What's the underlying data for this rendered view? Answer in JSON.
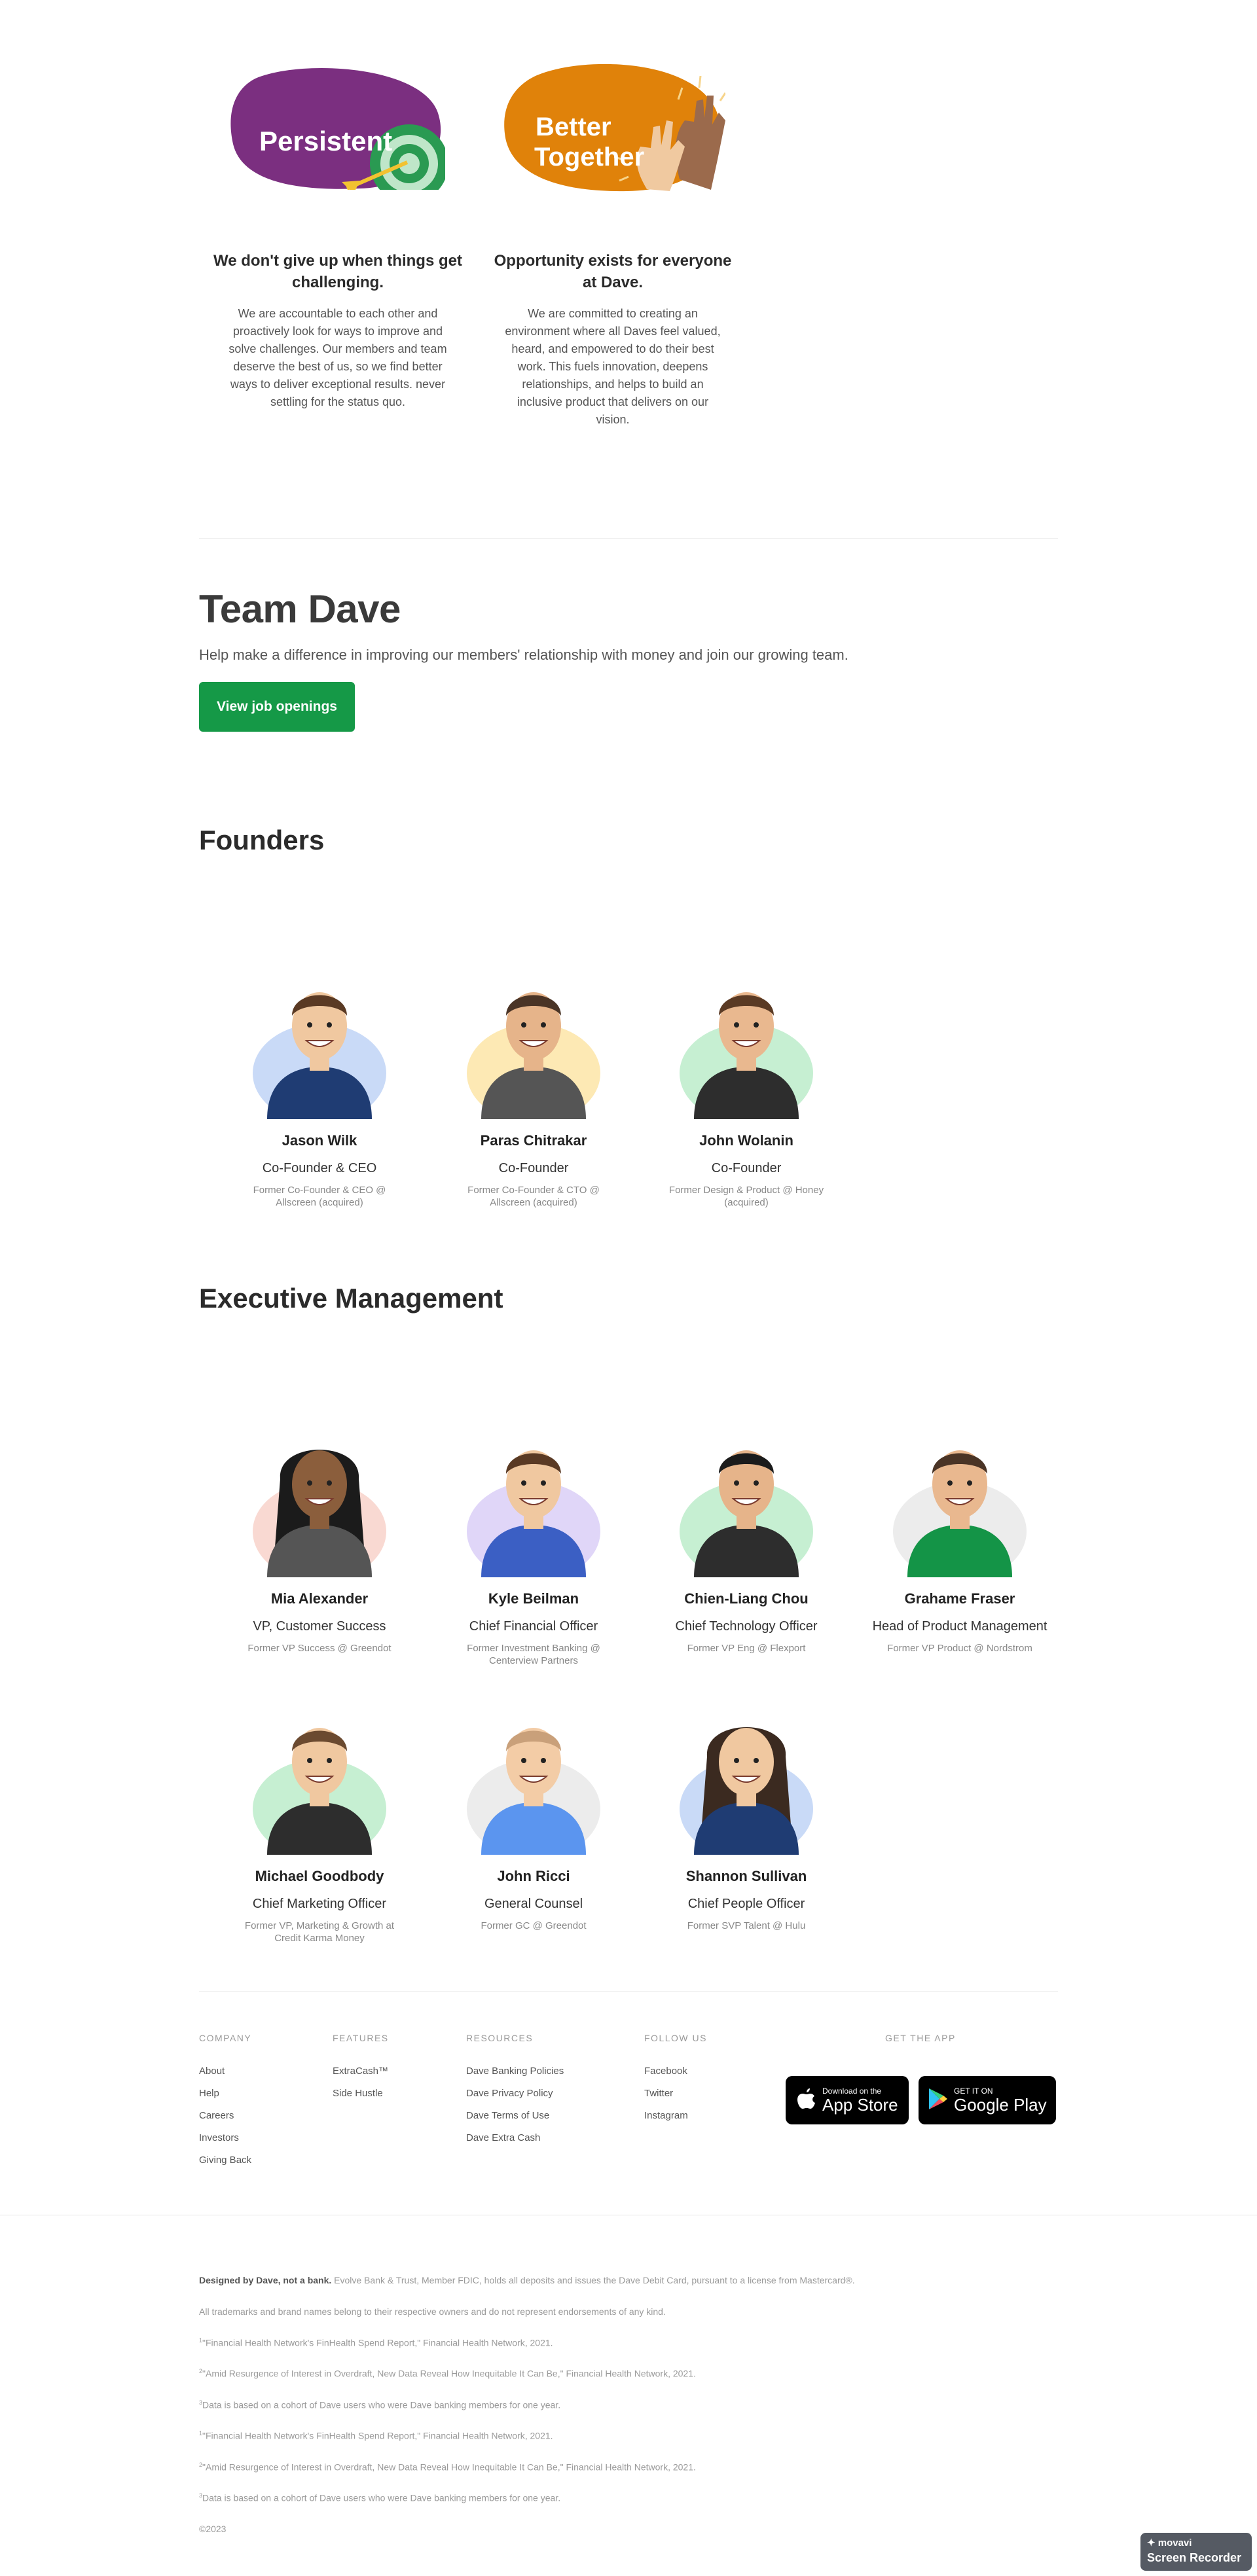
{
  "values": [
    {
      "badge": "Persistent",
      "title": "We don't give up when things get challenging.",
      "body": "We are accountable to each other and proactively look for ways to improve and solve challenges. Our members and team deserve the best of us, so we find better ways to deliver exceptional results. never settling for the status quo.",
      "color": "#7b2f80"
    },
    {
      "badge_line1": "Better",
      "badge_line2": "Together",
      "title": "Opportunity exists for everyone at Dave.",
      "body": "We are committed to creating an environment where all Daves feel valued, heard, and empowered to do their best work. This fuels innovation, deepens relationships, and helps to build an inclusive product that delivers on our vision.",
      "color": "#e0820a"
    }
  ],
  "team": {
    "title": "Team Dave",
    "subtitle": "Help make a difference in improving our members' relationship with money and join our growing team.",
    "button": "View job openings",
    "accent": "#159947"
  },
  "founders": {
    "heading": "Founders",
    "people": [
      {
        "name": "Jason Wilk",
        "role": "Co-Founder & CEO",
        "prev": "Former Co-Founder & CEO @ Allscreen (acquired)"
      },
      {
        "name": "Paras Chitrakar",
        "role": "Co-Founder",
        "prev": "Former Co-Founder & CTO @ Allscreen (acquired)"
      },
      {
        "name": "John Wolanin",
        "role": "Co-Founder",
        "prev": "Former Design & Product @ Honey (acquired)"
      }
    ]
  },
  "executives": {
    "heading": "Executive Management",
    "people": [
      {
        "name": "Mia Alexander",
        "role": "VP, Customer Success",
        "prev": "Former VP Success @ Greendot"
      },
      {
        "name": "Kyle Beilman",
        "role": "Chief Financial Officer",
        "prev": "Former Investment Banking @ Centerview Partners"
      },
      {
        "name": "Chien-Liang Chou",
        "role": "Chief Technology Officer",
        "prev": "Former VP Eng @ Flexport"
      },
      {
        "name": "Grahame Fraser",
        "role": "Head of Product Management",
        "prev": "Former VP Product @ Nordstrom"
      },
      {
        "name": "Michael Goodbody",
        "role": "Chief Marketing Officer",
        "prev": "Former VP, Marketing & Growth at Credit Karma Money"
      },
      {
        "name": "John Ricci",
        "role": "General Counsel",
        "prev": "Former GC @ Greendot"
      },
      {
        "name": "Shannon Sullivan",
        "role": "Chief People Officer",
        "prev": "Former SVP Talent @ Hulu"
      }
    ]
  },
  "footer": {
    "company": {
      "heading": "COMPANY",
      "links": [
        "About",
        "Help",
        "Careers",
        "Investors",
        "Giving Back"
      ]
    },
    "features": {
      "heading": "FEATURES",
      "links": [
        "ExtraCash™",
        "Side Hustle"
      ]
    },
    "resources": {
      "heading": "RESOURCES",
      "links": [
        "Dave Banking Policies",
        "Dave Privacy Policy",
        "Dave Terms of Use",
        "Dave Extra Cash"
      ]
    },
    "follow": {
      "heading": "FOLLOW US",
      "links": [
        "Facebook",
        "Twitter",
        "Instagram"
      ]
    },
    "app": {
      "heading": "GET THE APP",
      "appstore_small": "Download on the",
      "appstore_big": "App Store",
      "play_small": "GET IT ON",
      "play_big": "Google Play"
    }
  },
  "legal": {
    "lead_bold": "Designed by Dave, not a bank.",
    "lead_rest": " Evolve Bank & Trust, Member FDIC, holds all deposits and issues the Dave Debit Card, pursuant to a license from Mastercard®.",
    "trademarks": "All trademarks and brand names belong to their respective owners and do not represent endorsements of any kind.",
    "notes": [
      {
        "sup": "1",
        "text": "\"Financial Health Network's FinHealth Spend Report,\" Financial Health Network, 2021."
      },
      {
        "sup": "2",
        "text": "\"Amid Resurgence of Interest in Overdraft, New Data Reveal How Inequitable It Can Be,\" Financial Health Network, 2021."
      },
      {
        "sup": "3",
        "text": "Data is based on a cohort of Dave users who were Dave banking members for one year."
      },
      {
        "sup": "1",
        "text": "\"Financial Health Network's FinHealth Spend Report,\" Financial Health Network, 2021."
      },
      {
        "sup": "2",
        "text": "\"Amid Resurgence of Interest in Overdraft, New Data Reveal How Inequitable It Can Be,\" Financial Health Network, 2021."
      },
      {
        "sup": "3",
        "text": "Data is based on a cohort of Dave users who were Dave banking members for one year."
      }
    ],
    "copyright": "©2023"
  },
  "recorder": {
    "brand": "movavi",
    "label": "Screen Recorder"
  }
}
